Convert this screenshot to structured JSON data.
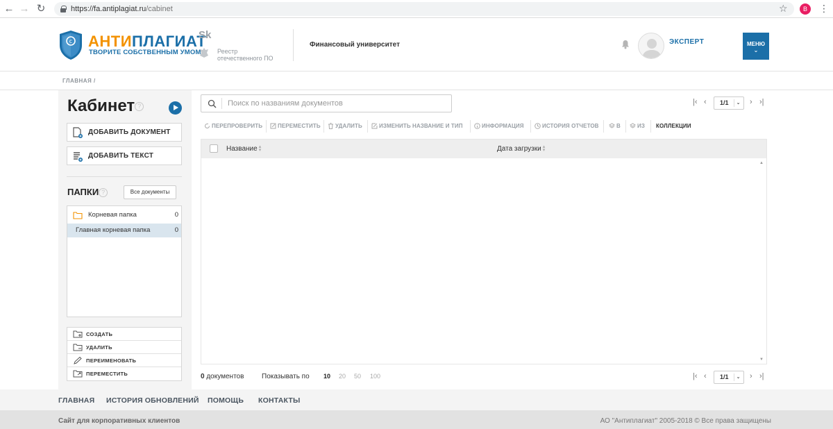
{
  "browser": {
    "url_host": "fa.antiplagiat.ru",
    "url_path": "/cabinet",
    "profile_letter": "B"
  },
  "header": {
    "logo_title_orange": "АНТИ",
    "logo_title_blue": "ПЛАГИАТ",
    "logo_subtitle": "ТВОРИТЕ СОБСТВЕННЫМ УМОМ",
    "sk_logo": "Sk",
    "reestr_line1": "Реестр",
    "reestr_line2": "отечественного ПО",
    "university": "Финансовый университет",
    "user_role": "ЭКСПЕРТ",
    "menu_label": "МЕНЮ"
  },
  "breadcrumb": "ГЛАВНАЯ /",
  "sidebar": {
    "title": "Кабинет",
    "add_document": "ДОБАВИТЬ ДОКУМЕНТ",
    "add_text": "ДОБАВИТЬ ТЕКСТ",
    "folders_title": "ПАПКИ",
    "all_documents": "Все документы",
    "folders": [
      {
        "name": "Корневая папка",
        "count": "0"
      },
      {
        "name": "Главная корневая папка",
        "count": "0"
      }
    ],
    "folder_actions": [
      {
        "label": "СОЗДАТЬ",
        "icon": "folder-plus-icon"
      },
      {
        "label": "УДАЛИТЬ",
        "icon": "folder-minus-icon"
      },
      {
        "label": "ПЕРЕИМЕНОВАТЬ",
        "icon": "pencil-icon"
      },
      {
        "label": "ПЕРЕМЕСТИТЬ",
        "icon": "folder-move-icon"
      }
    ]
  },
  "content": {
    "search_placeholder": "Поиск по названиям документов",
    "page_current": "1/1",
    "toolbar": {
      "recheck": "ПЕРЕПРОВЕРИТЬ",
      "move": "ПЕРЕМЕСТИТЬ",
      "delete": "УДАЛИТЬ",
      "rename": "ИЗМЕНИТЬ НАЗВАНИЕ И ТИП",
      "info": "ИНФОРМАЦИЯ",
      "history": "ИСТОРИЯ ОТЧЕТОВ",
      "in": "В",
      "out": "ИЗ",
      "collections": "КОЛЛЕКЦИИ"
    },
    "table": {
      "col_name": "Название",
      "col_date": "Дата загрузки"
    },
    "doc_count": "0",
    "doc_count_label": "документов",
    "show_per_page": "Показывать по",
    "page_sizes": [
      "10",
      "20",
      "50",
      "100"
    ],
    "active_page_size": "10"
  },
  "footer": {
    "nav": [
      "ГЛАВНАЯ",
      "ИСТОРИЯ ОБНОВЛЕНИЙ",
      "ПОМОЩЬ",
      "КОНТАКТЫ"
    ],
    "left": "Сайт для корпоративных клиентов",
    "right": "АО \"Антиплагиат\" 2005-2018 © Все права защищены"
  },
  "colors": {
    "brand_blue": "#1b6fa8",
    "brand_orange": "#f39200",
    "selected_row": "#d9e5ee"
  }
}
